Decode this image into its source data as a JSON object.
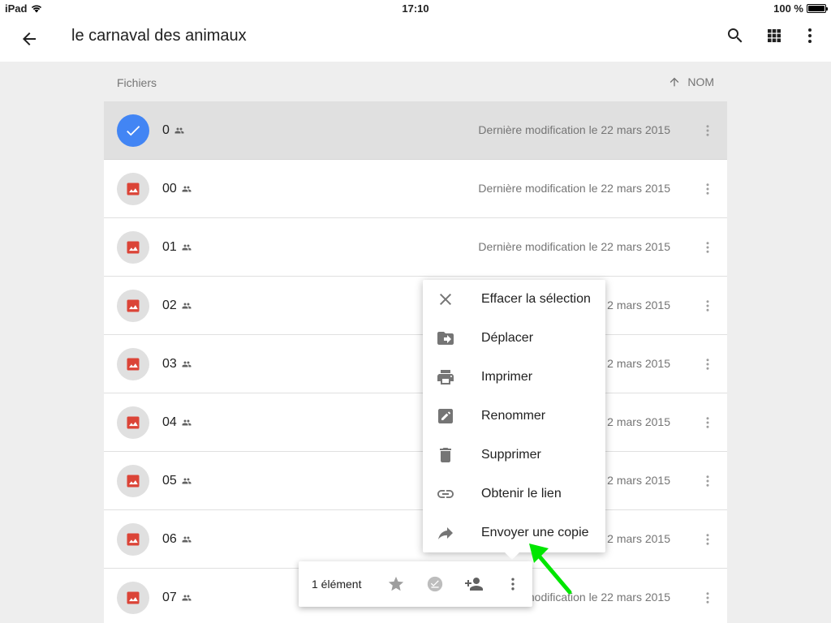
{
  "status_bar": {
    "device": "iPad",
    "time": "17:10",
    "battery": "100 %"
  },
  "app_bar": {
    "title": "le carnaval des animaux",
    "back_icon": "arrow-back-icon",
    "search_icon": "search-icon",
    "grid_icon": "grid-view-icon",
    "more_icon": "more-vert-icon"
  },
  "list_header": {
    "section_label": "Fichiers",
    "sort_label": "NOM"
  },
  "files": [
    {
      "name": "0",
      "date": "Dernière modification le 22 mars 2015",
      "selected": true
    },
    {
      "name": "00",
      "date": "Dernière modification le 22 mars 2015",
      "selected": false
    },
    {
      "name": "01",
      "date": "Dernière modification le 22 mars 2015",
      "selected": false
    },
    {
      "name": "02",
      "date": "2 mars 2015",
      "selected": false
    },
    {
      "name": "03",
      "date": "2 mars 2015",
      "selected": false
    },
    {
      "name": "04",
      "date": "2 mars 2015",
      "selected": false
    },
    {
      "name": "05",
      "date": "2 mars 2015",
      "selected": false
    },
    {
      "name": "06",
      "date": "2 mars 2015",
      "selected": false
    },
    {
      "name": "07",
      "date": "nodification le 22 mars 2015",
      "selected": false
    }
  ],
  "menu": {
    "items": [
      {
        "label": "Effacer la sélection",
        "icon": "close-icon"
      },
      {
        "label": "Déplacer",
        "icon": "move-to-folder-icon"
      },
      {
        "label": "Imprimer",
        "icon": "print-icon"
      },
      {
        "label": "Renommer",
        "icon": "rename-icon"
      },
      {
        "label": "Supprimer",
        "icon": "trash-icon"
      },
      {
        "label": "Obtenir le lien",
        "icon": "link-icon"
      },
      {
        "label": "Envoyer une copie",
        "icon": "share-arrow-icon"
      }
    ]
  },
  "selection_bar": {
    "count_label": "1 élément"
  },
  "colors": {
    "accent": "#4285f4",
    "image_icon": "#db4437",
    "annotation": "#00e600"
  }
}
